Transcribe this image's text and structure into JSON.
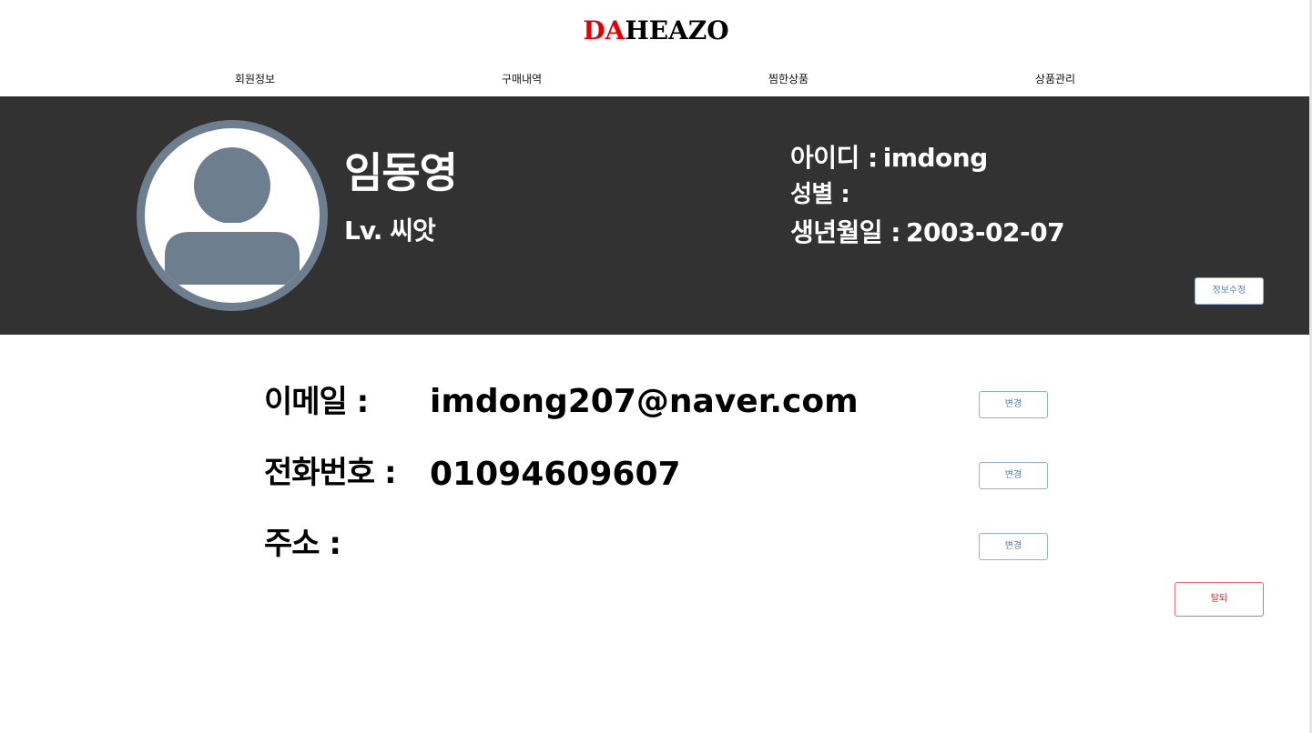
{
  "brand": {
    "accent_text": "DA",
    "rest_text": "HEAZO",
    "accent_color": "#e00000"
  },
  "nav": {
    "items": [
      {
        "label": "회원정보"
      },
      {
        "label": "구매내역"
      },
      {
        "label": "찜한상품"
      },
      {
        "label": "상품관리"
      }
    ]
  },
  "profile": {
    "avatar_icon": "user-silhouette-icon",
    "name": "임동영",
    "level": "Lv. 씨앗",
    "id_label": "아이디 :",
    "id_value": "imdong",
    "gender_label": "성별 :",
    "gender_value": "",
    "birth_label": "생년월일 :",
    "birth_value": "2003-02-07",
    "edit_button": "정보수정",
    "band_color": "#323232"
  },
  "contact": {
    "email_label": "이메일 :",
    "email_value": "imdong207@naver.com",
    "phone_label": "전화번호 :",
    "phone_value": "01094609607",
    "address_label": "주소 :",
    "address_value": "",
    "change_button": "변경"
  },
  "withdraw_button": "탈퇴"
}
